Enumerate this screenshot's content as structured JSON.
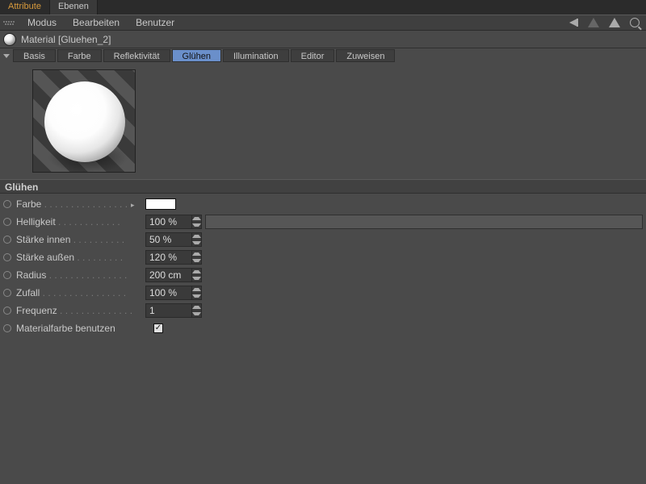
{
  "top_tabs": {
    "attribute": "Attribute",
    "ebenen": "Ebenen"
  },
  "menubar": {
    "modus": "Modus",
    "bearbeiten": "Bearbeiten",
    "benutzer": "Benutzer"
  },
  "material_header": "Material [Gluehen_2]",
  "channel_tabs": {
    "basis": "Basis",
    "farbe": "Farbe",
    "reflektivitaet": "Reflektivität",
    "gluehen": "Glühen",
    "illumination": "Illumination",
    "editor": "Editor",
    "zuweisen": "Zuweisen"
  },
  "section_title": "Glühen",
  "props": {
    "farbe": {
      "label": "Farbe",
      "swatch": "#ffffff"
    },
    "helligkeit": {
      "label": "Helligkeit",
      "value": "100 %"
    },
    "staerke_innen": {
      "label": "Stärke innen",
      "value": "50 %"
    },
    "staerke_aussen": {
      "label": "Stärke außen",
      "value": "120 %"
    },
    "radius": {
      "label": "Radius",
      "value": "200 cm"
    },
    "zufall": {
      "label": "Zufall",
      "value": "100 %"
    },
    "frequenz": {
      "label": "Frequenz",
      "value": "1"
    },
    "materialfarbe": {
      "label": "Materialfarbe benutzen",
      "checked": true
    }
  }
}
